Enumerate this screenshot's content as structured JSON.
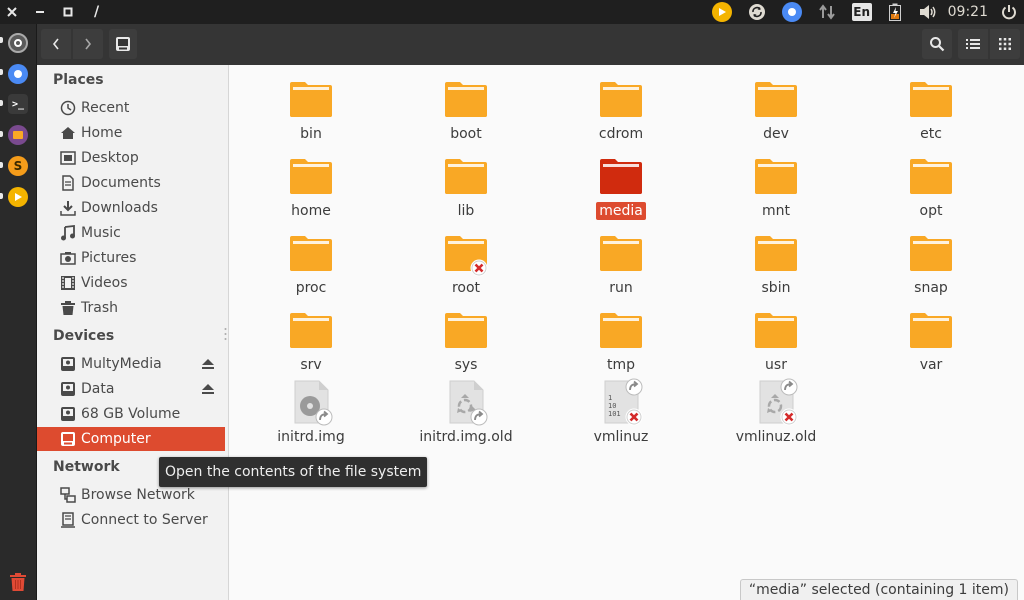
{
  "window": {
    "title": "/"
  },
  "top_panel": {
    "clock": "09:21",
    "language": "En",
    "indicators": [
      "media-player-icon",
      "sync-icon",
      "chromium-icon",
      "network-arrows-icon",
      "language-indicator",
      "battery-icon",
      "volume-icon",
      "clock",
      "power-icon"
    ]
  },
  "launcher": {
    "items": [
      "ubuntu-icon",
      "chromium-icon",
      "terminal-icon",
      "files-icon",
      "sublime-text-icon",
      "media-player-icon"
    ],
    "trash": "trash-icon"
  },
  "sidebar": {
    "places_heading": "Places",
    "places": [
      {
        "label": "Recent",
        "icon": "clock-icon"
      },
      {
        "label": "Home",
        "icon": "home-icon"
      },
      {
        "label": "Desktop",
        "icon": "desktop-icon"
      },
      {
        "label": "Documents",
        "icon": "document-icon"
      },
      {
        "label": "Downloads",
        "icon": "download-icon"
      },
      {
        "label": "Music",
        "icon": "music-icon"
      },
      {
        "label": "Pictures",
        "icon": "camera-icon"
      },
      {
        "label": "Videos",
        "icon": "film-icon"
      },
      {
        "label": "Trash",
        "icon": "trash-icon"
      }
    ],
    "devices_heading": "Devices",
    "devices": [
      {
        "label": "MultyMedia",
        "icon": "drive-icon",
        "eject": true
      },
      {
        "label": "Data",
        "icon": "drive-icon",
        "eject": true
      },
      {
        "label": "68 GB Volume",
        "icon": "drive-icon",
        "eject": false
      },
      {
        "label": "Computer",
        "icon": "computer-icon",
        "eject": false,
        "selected": true
      }
    ],
    "network_heading": "Network",
    "network": [
      {
        "label": "Browse Network",
        "icon": "network-icon"
      },
      {
        "label": "Connect to Server",
        "icon": "server-icon"
      }
    ]
  },
  "files": [
    {
      "name": "bin",
      "type": "folder"
    },
    {
      "name": "boot",
      "type": "folder"
    },
    {
      "name": "cdrom",
      "type": "folder"
    },
    {
      "name": "dev",
      "type": "folder"
    },
    {
      "name": "etc",
      "type": "folder"
    },
    {
      "name": "home",
      "type": "folder"
    },
    {
      "name": "lib",
      "type": "folder"
    },
    {
      "name": "media",
      "type": "folder",
      "selected": true
    },
    {
      "name": "mnt",
      "type": "folder"
    },
    {
      "name": "opt",
      "type": "folder"
    },
    {
      "name": "proc",
      "type": "folder"
    },
    {
      "name": "root",
      "type": "folder",
      "locked": true
    },
    {
      "name": "run",
      "type": "folder"
    },
    {
      "name": "sbin",
      "type": "folder"
    },
    {
      "name": "snap",
      "type": "folder"
    },
    {
      "name": "srv",
      "type": "folder"
    },
    {
      "name": "sys",
      "type": "folder"
    },
    {
      "name": "tmp",
      "type": "folder"
    },
    {
      "name": "usr",
      "type": "folder"
    },
    {
      "name": "var",
      "type": "folder"
    },
    {
      "name": "initrd.img",
      "type": "disk-image-link"
    },
    {
      "name": "initrd.img.old",
      "type": "broken-link"
    },
    {
      "name": "vmlinuz",
      "type": "binary-link-locked"
    },
    {
      "name": "vmlinuz.old",
      "type": "broken-link-locked"
    }
  ],
  "tooltip": "Open the contents of the file system",
  "status": "“media” selected  (containing 1 item)",
  "colors": {
    "accent": "#dd4b2f",
    "folder": "#f9a825",
    "folder_selected": "#d02b0e"
  }
}
